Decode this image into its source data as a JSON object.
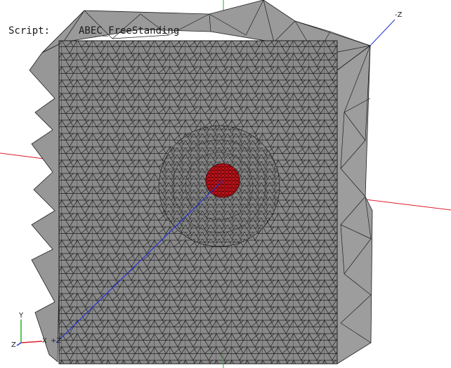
{
  "script": {
    "label": "Script:",
    "name": "ABEC_FreeStanding"
  },
  "axes": {
    "corner_z_label": "-Z",
    "triad_y": "Y",
    "triad_z": "Z",
    "triad_x": "X",
    "triad_plus_z": "+Z"
  },
  "colors": {
    "background": "#ffffff",
    "mesh_fill": "#8c8c8c",
    "mesh_front": "#7d7d7d",
    "mesh_lines": "#1e1e1e",
    "source_fill": "#c0141c",
    "axis_x": "#e01c2c",
    "axis_y": "#1fb51f",
    "axis_z": "#2431d8"
  }
}
